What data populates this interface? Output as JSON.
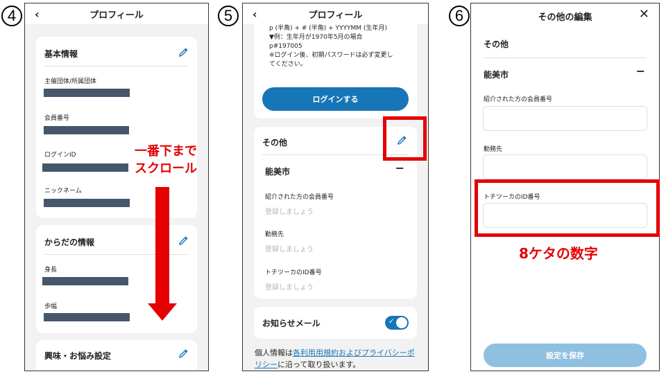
{
  "steps": {
    "s4": "4",
    "s5": "5",
    "s6": "6"
  },
  "panel4": {
    "title": "プロフィール",
    "basic": {
      "title": "基本情報",
      "fields": [
        "主催団体/所属団体",
        "会員番号",
        "ログインID",
        "ニックネーム"
      ]
    },
    "body": {
      "title": "からだの情報",
      "fields": [
        "身長",
        "歩幅"
      ]
    },
    "interests": {
      "title": "興味・お悩み設定"
    },
    "annotation_line1": "一番下まで",
    "annotation_line2": "スクロール"
  },
  "panel5": {
    "title": "プロフィール",
    "note_lines": [
      "p (半角) + # (半角) + YYYYMM (生年月)",
      "▼例：生年月が1970年5月の場合",
      "p#197005",
      "※ログイン後、初期パスワードは必ず変更し",
      "てください。"
    ],
    "login_button": "ログインする",
    "other": {
      "title": "その他",
      "group": "能美市",
      "collapse_symbol": "−",
      "fields": [
        {
          "label": "紹介された方の会員番号",
          "placeholder": "登録しましょう"
        },
        {
          "label": "勤務先",
          "placeholder": "登録しましょう"
        },
        {
          "label": "トチツーカのID番号",
          "placeholder": "登録しましょう"
        }
      ]
    },
    "notify": {
      "label": "お知らせメール",
      "enabled": true
    },
    "policy_before": "個人情報は",
    "policy_link": "各利用用規約およびプライバシーポリシー",
    "policy_after": "に沿って取り扱います。"
  },
  "panel6": {
    "title": "その他の編集",
    "close_symbol": "✕",
    "section": "その他",
    "group": "能美市",
    "collapse_symbol": "−",
    "fields": [
      {
        "label": "紹介された方の会員番号",
        "value": ""
      },
      {
        "label": "勤務先",
        "value": ""
      },
      {
        "label": "トチツーカのID番号",
        "value": ""
      }
    ],
    "annotation": "8ケタの数字",
    "save_button": "設定を保存"
  },
  "colors": {
    "accent": "#1676b8",
    "save_disabled": "#8fc0e0",
    "annotation_red": "#e60000",
    "redacted": "#46566b"
  }
}
